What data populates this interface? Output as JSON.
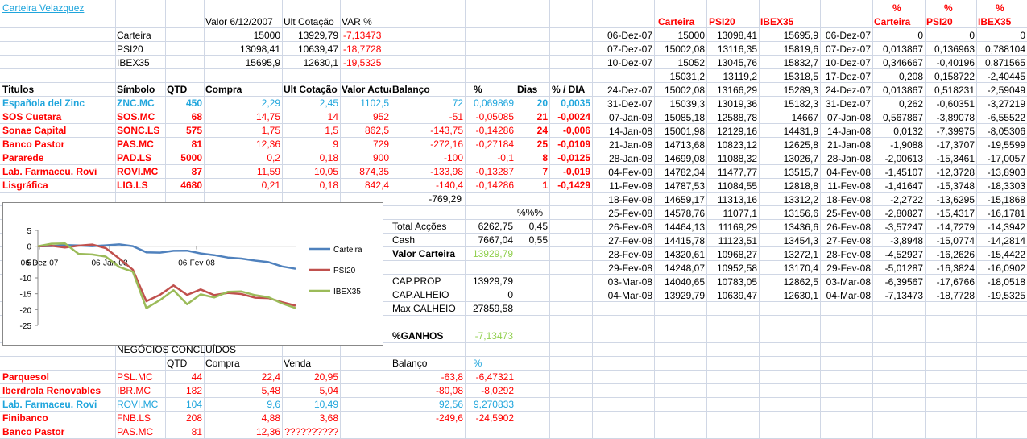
{
  "title": "Carteira Velazquez",
  "summary": {
    "headers": [
      "Valor 6/12/2007",
      "Ult Cotação",
      "VAR %"
    ],
    "rows": [
      {
        "label": "Carteira",
        "v1": "15000",
        "v2": "13929,79",
        "var": "-7,13473"
      },
      {
        "label": "PSI20",
        "v1": "13098,41",
        "v2": "10639,47",
        "var": "-18,7728"
      },
      {
        "label": "IBEX35",
        "v1": "15695,9",
        "v2": "12630,1",
        "var": "-19,5325"
      }
    ]
  },
  "holdings": {
    "headers": [
      "Titulos",
      "Símbolo",
      "QTD",
      "Compra",
      "Ult Cotação",
      "Valor Actual",
      "Balanço",
      "%",
      "Dias",
      "% / DIA"
    ],
    "rows": [
      {
        "name": "Española del Zinc",
        "sym": "ZNC.MC",
        "qtd": "450",
        "compra": "2,29",
        "ult": "2,45",
        "valor": "1102,5",
        "bal": "72",
        "pct": "0,069869",
        "dias": "20",
        "dia": "0,0035",
        "color": "blue"
      },
      {
        "name": "SOS Cuetara",
        "sym": "SOS.MC",
        "qtd": "68",
        "compra": "14,75",
        "ult": "14",
        "valor": "952",
        "bal": "-51",
        "pct": "-0,05085",
        "dias": "21",
        "dia": "-0,0024",
        "color": "red"
      },
      {
        "name": "Sonae Capital",
        "sym": "SONC.LS",
        "qtd": "575",
        "compra": "1,75",
        "ult": "1,5",
        "valor": "862,5",
        "bal": "-143,75",
        "pct": "-0,14286",
        "dias": "24",
        "dia": "-0,006",
        "color": "red"
      },
      {
        "name": "Banco Pastor",
        "sym": "PAS.MC",
        "qtd": "81",
        "compra": "12,36",
        "ult": "9",
        "valor": "729",
        "bal": "-272,16",
        "pct": "-0,27184",
        "dias": "25",
        "dia": "-0,0109",
        "color": "red"
      },
      {
        "name": "Pararede",
        "sym": "PAD.LS",
        "qtd": "5000",
        "compra": "0,2",
        "ult": "0,18",
        "valor": "900",
        "bal": "-100",
        "pct": "-0,1",
        "dias": "8",
        "dia": "-0,0125",
        "color": "red"
      },
      {
        "name": "Lab. Farmaceu. Rovi",
        "sym": "ROVI.MC",
        "qtd": "87",
        "compra": "11,59",
        "ult": "10,05",
        "valor": "874,35",
        "bal": "-133,98",
        "pct": "-0,13287",
        "dias": "7",
        "dia": "-0,019",
        "color": "red"
      },
      {
        "name": "Lisgráfica",
        "sym": "LIG.LS",
        "qtd": "4680",
        "compra": "0,21",
        "ult": "0,18",
        "valor": "842,4",
        "bal": "-140,4",
        "pct": "-0,14286",
        "dias": "1",
        "dia": "-0,1429",
        "color": "red"
      }
    ],
    "total_balance": "-769,29"
  },
  "totals": {
    "pct_header": "%%%",
    "acc_label": "Total Acções",
    "acc_value": "6262,75",
    "acc_pct": "0,45",
    "cash_label": "Cash",
    "cash_value": "7667,04",
    "cash_pct": "0,55",
    "vc_label": "Valor Carteira",
    "vc_value": "13929,79",
    "capprop_label": "CAP.PROP",
    "capprop_value": "13929,79",
    "capalheio_label": "CAP.ALHEIO",
    "capalheio_value": "0",
    "maxcalheio_label": "Max CALHEIO",
    "maxcalheio_value": "27859,58",
    "ganhos_label": "%GANHOS",
    "ganhos_value": "-7,13473"
  },
  "closed": {
    "title": "NEGÓCIOS CONCLUÍDOS",
    "headers": [
      "QTD",
      "Compra",
      "Venda",
      "Balanço",
      "%"
    ],
    "rows": [
      {
        "name": "Parquesol",
        "sym": "PSL.MC",
        "qtd": "44",
        "compra": "22,4",
        "venda": "20,95",
        "bal": "-63,8",
        "pct": "-6,47321",
        "color": "red"
      },
      {
        "name": "Iberdrola Renovables",
        "sym": "IBR.MC",
        "qtd": "182",
        "compra": "5,48",
        "venda": "5,04",
        "bal": "-80,08",
        "pct": "-8,0292",
        "color": "red"
      },
      {
        "name": "Lab. Farmaceu. Rovi",
        "sym": "ROVI.MC",
        "qtd": "104",
        "compra": "9,6",
        "venda": "10,49",
        "bal": "92,56",
        "pct": "9,270833",
        "color": "blue"
      },
      {
        "name": "Finibanco",
        "sym": "FNB.LS",
        "qtd": "208",
        "compra": "4,88",
        "venda": "3,68",
        "bal": "-249,6",
        "pct": "-24,5902",
        "color": "red"
      },
      {
        "name": "Banco Pastor",
        "sym": "PAS.MC",
        "qtd": "81",
        "compra": "12,36",
        "venda": "??????????",
        "bal": "",
        "pct": "",
        "color": "red"
      }
    ]
  },
  "history": {
    "headers": [
      "Carteira",
      "PSI20",
      "IBEX35"
    ],
    "pct_label": "%",
    "rows": [
      {
        "date": "06-Dez-07",
        "c": "15000",
        "p": "13098,41",
        "i": "15695,9",
        "pc": "0",
        "pp": "0",
        "pi": "0"
      },
      {
        "date": "07-Dez-07",
        "c": "15002,08",
        "p": "13116,35",
        "i": "15819,6",
        "pc": "0,013867",
        "pp": "0,136963",
        "pi": "0,788104"
      },
      {
        "date": "10-Dez-07",
        "c": "15052",
        "p": "13045,76",
        "i": "15832,7",
        "pc": "0,346667",
        "pp": "-0,40196",
        "pi": "0,871565"
      },
      {
        "date": "17-Dez-07",
        "c": "15031,2",
        "p": "13119,2",
        "i": "15318,5",
        "pc": "0,208",
        "pp": "0,158722",
        "pi": "-2,40445"
      },
      {
        "date": "24-Dez-07",
        "c": "15002,08",
        "p": "13166,29",
        "i": "15289,3",
        "pc": "0,013867",
        "pp": "0,518231",
        "pi": "-2,59049"
      },
      {
        "date": "31-Dez-07",
        "c": "15039,3",
        "p": "13019,36",
        "i": "15182,3",
        "pc": "0,262",
        "pp": "-0,60351",
        "pi": "-3,27219"
      },
      {
        "date": "07-Jan-08",
        "c": "15085,18",
        "p": "12588,78",
        "i": "14667",
        "pc": "0,567867",
        "pp": "-3,89078",
        "pi": "-6,55522"
      },
      {
        "date": "14-Jan-08",
        "c": "15001,98",
        "p": "12129,16",
        "i": "14431,9",
        "pc": "0,0132",
        "pp": "-7,39975",
        "pi": "-8,05306"
      },
      {
        "date": "21-Jan-08",
        "c": "14713,68",
        "p": "10823,12",
        "i": "12625,8",
        "pc": "-1,9088",
        "pp": "-17,3707",
        "pi": "-19,5599"
      },
      {
        "date": "28-Jan-08",
        "c": "14699,08",
        "p": "11088,32",
        "i": "13026,7",
        "pc": "-2,00613",
        "pp": "-15,3461",
        "pi": "-17,0057"
      },
      {
        "date": "04-Fev-08",
        "c": "14782,34",
        "p": "11477,77",
        "i": "13515,7",
        "pc": "-1,45107",
        "pp": "-12,3728",
        "pi": "-13,8903"
      },
      {
        "date": "11-Fev-08",
        "c": "14787,53",
        "p": "11084,55",
        "i": "12818,8",
        "pc": "-1,41647",
        "pp": "-15,3748",
        "pi": "-18,3303"
      },
      {
        "date": "18-Fev-08",
        "c": "14659,17",
        "p": "11313,16",
        "i": "13312,2",
        "pc": "-2,2722",
        "pp": "-13,6295",
        "pi": "-15,1868"
      },
      {
        "date": "25-Fev-08",
        "c": "14578,76",
        "p": "11077,1",
        "i": "13156,6",
        "pc": "-2,80827",
        "pp": "-15,4317",
        "pi": "-16,1781"
      },
      {
        "date": "26-Fev-08",
        "c": "14464,13",
        "p": "11169,29",
        "i": "13436,6",
        "pc": "-3,57247",
        "pp": "-14,7279",
        "pi": "-14,3942"
      },
      {
        "date": "27-Fev-08",
        "c": "14415,78",
        "p": "11123,51",
        "i": "13454,3",
        "pc": "-3,8948",
        "pp": "-15,0774",
        "pi": "-14,2814"
      },
      {
        "date": "28-Fev-08",
        "c": "14320,61",
        "p": "10968,27",
        "i": "13272,1",
        "pc": "-4,52927",
        "pp": "-16,2626",
        "pi": "-15,4422"
      },
      {
        "date": "29-Fev-08",
        "c": "14248,07",
        "p": "10952,58",
        "i": "13170,4",
        "pc": "-5,01287",
        "pp": "-16,3824",
        "pi": "-16,0902"
      },
      {
        "date": "03-Mar-08",
        "c": "14040,65",
        "p": "10783,05",
        "i": "12862,5",
        "pc": "-6,39567",
        "pp": "-17,6766",
        "pi": "-18,0518"
      },
      {
        "date": "04-Mar-08",
        "c": "13929,79",
        "p": "10639,47",
        "i": "12630,1",
        "pc": "-7,13473",
        "pp": "-18,7728",
        "pi": "-19,5325"
      }
    ]
  },
  "chart_data": {
    "type": "line",
    "x": [
      "06-Dez-07",
      "07-Dez-07",
      "10-Dez-07",
      "17-Dez-07",
      "24-Dez-07",
      "31-Dez-07",
      "07-Jan-08",
      "14-Jan-08",
      "21-Jan-08",
      "28-Jan-08",
      "04-Fev-08",
      "11-Fev-08",
      "18-Fev-08",
      "25-Fev-08",
      "26-Fev-08",
      "27-Fev-08",
      "28-Fev-08",
      "29-Fev-08",
      "03-Mar-08",
      "04-Mar-08"
    ],
    "x_tick_labels": [
      "06-Dez-07",
      "06-Jan-08",
      "06-Fev-08"
    ],
    "y_ticks": [
      5,
      0,
      -5,
      -10,
      -15,
      -20,
      -25
    ],
    "ylim": [
      -25,
      5
    ],
    "legend_position": "right",
    "series": [
      {
        "name": "Carteira",
        "color": "#4f81bd",
        "values": [
          0,
          0.013867,
          0.346667,
          0.208,
          0.013867,
          0.262,
          0.567867,
          0.0132,
          -1.9088,
          -2.00613,
          -1.45107,
          -1.41647,
          -2.2722,
          -2.80827,
          -3.57247,
          -3.8948,
          -4.52927,
          -5.01287,
          -6.39567,
          -7.13473
        ]
      },
      {
        "name": "PSI20",
        "color": "#c0504d",
        "values": [
          0,
          0.136963,
          -0.40196,
          0.158722,
          0.518231,
          -0.60351,
          -3.89078,
          -7.39975,
          -17.3707,
          -15.3461,
          -12.3728,
          -15.3748,
          -13.6295,
          -15.4317,
          -14.7279,
          -15.0774,
          -16.2626,
          -16.3824,
          -17.6766,
          -18.7728
        ]
      },
      {
        "name": "IBEX35",
        "color": "#9bbb59",
        "values": [
          0,
          0.788104,
          0.871565,
          -2.40445,
          -2.59049,
          -3.27219,
          -6.55522,
          -8.05306,
          -19.5599,
          -17.0057,
          -13.8903,
          -18.3303,
          -15.1868,
          -16.1781,
          -14.3942,
          -14.2814,
          -15.4422,
          -16.0902,
          -18.0518,
          -19.5325
        ]
      }
    ]
  }
}
